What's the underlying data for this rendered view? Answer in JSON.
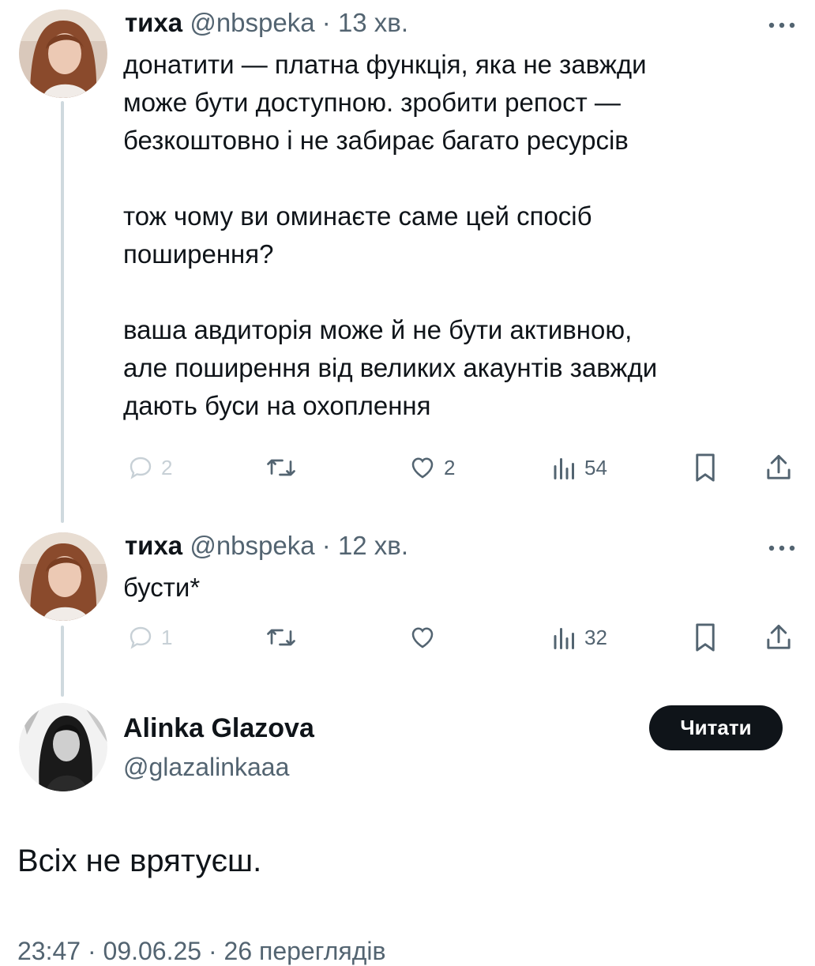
{
  "tweets": [
    {
      "display_name": "тиха",
      "handle": "@nbspeka",
      "separator": "·",
      "time": "13 хв.",
      "text": "донатити — платна функція, яка не завжди\nможе бути доступною. зробити репост —\nбезкоштовно і не забирає багато ресурсів\n\nтож чому ви оминаєте саме цей спосіб\nпоширення?\n\nваша авдиторія може й не бути активною,\nале поширення від великих акаунтів завжди\nдають буси на охоплення",
      "replies": "2",
      "likes": "2",
      "views": "54"
    },
    {
      "display_name": "тиха",
      "handle": "@nbspeka",
      "separator": "·",
      "time": "12 хв.",
      "text": "бусти*",
      "replies": "1",
      "likes": "",
      "views": "32"
    }
  ],
  "quoted_user": {
    "display_name": "Alinka Glazova",
    "handle": "@glazalinkaaa",
    "follow_label": "Читати",
    "text": "Всіх не врятуєш."
  },
  "footer_partial": "23:47 · 09.06.25 · 26 переглядів",
  "colors": {
    "text": "#0f1419",
    "muted": "#536471",
    "thread_line": "#cfd9de",
    "button_bg": "#0f1419"
  },
  "icons": [
    "reply-icon",
    "retweet-icon",
    "like-icon",
    "views-icon",
    "bookmark-icon",
    "share-icon",
    "more-icon"
  ]
}
